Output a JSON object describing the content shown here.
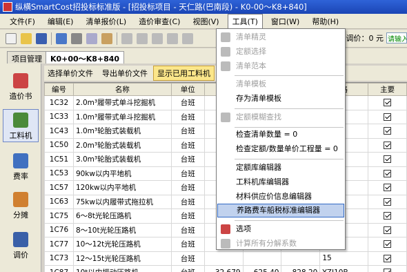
{
  "title": "纵横SmartCost招投标标准版 - [招投标项目 - 天仁路(巴南段) - K0-00～K8+840]",
  "menu": [
    "文件(F)",
    "编辑(E)",
    "清单报价(L)",
    "造价审查(C)",
    "视图(V)",
    "工具(T)",
    "窗口(W)",
    "帮助(H)"
  ],
  "toolbar": {
    "price_label": "调价：0 元",
    "input_placeholder": "请输入"
  },
  "tabs": [
    "项目管理",
    "K0+00～K8+840"
  ],
  "sidebar": [
    "造价书",
    "工料机",
    "费率",
    "分摊",
    "调价"
  ],
  "subtoolbar": [
    "选择单价文件",
    "导出单价文件",
    "显示已用工料机"
  ],
  "table": {
    "headers": [
      "编号",
      "名称",
      "单位",
      "消",
      "",
      "",
      "格",
      "主要"
    ],
    "rows": [
      {
        "code": "1C32",
        "name": "2.0m³履带式单斗挖掘机",
        "unit": "台班",
        "v1": "",
        "v2": "",
        "v3": "",
        "spec": "五"
      },
      {
        "code": "1C33",
        "name": "1.0m³履带式单斗挖掘机",
        "unit": "台班",
        "v1": "",
        "v2": "",
        "v3": "",
        "spec": ""
      },
      {
        "code": "1C43",
        "name": "1.0m³轮胎式装载机",
        "unit": "台班",
        "v1": "",
        "v2": "",
        "v3": "",
        "spec": ""
      },
      {
        "code": "1C50",
        "name": "2.0m³轮胎式装载机",
        "unit": "台班",
        "v1": "",
        "v2": "",
        "v3": "",
        "spec": ""
      },
      {
        "code": "1C51",
        "name": "3.0m³轮胎式装载机",
        "unit": "台班",
        "v1": "",
        "v2": "",
        "v3": "",
        "spec": ""
      },
      {
        "code": "1C53",
        "name": "90kw以内平地机",
        "unit": "台班",
        "v1": "",
        "v2": "",
        "v3": "",
        "spec": ""
      },
      {
        "code": "1C57",
        "name": "120kw以内平地机",
        "unit": "台班",
        "v1": "",
        "v2": "",
        "v3": "",
        "spec": ""
      },
      {
        "code": "1C63",
        "name": "75kw以内履带式拖拉机",
        "unit": "台班",
        "v1": "",
        "v2": "",
        "v3": "",
        "spec": ""
      },
      {
        "code": "1C75",
        "name": "6～8t光轮压路机",
        "unit": "台班",
        "v1": "",
        "v2": "",
        "v3": "",
        "spec": ""
      },
      {
        "code": "1C76",
        "name": "8～10t光轮压路机",
        "unit": "台班",
        "v1": "",
        "v2": "",
        "v3": "",
        "spec": "10"
      },
      {
        "code": "1C77",
        "name": "10～12t光轮压路机",
        "unit": "台班",
        "v1": "",
        "v2": "",
        "v3": "",
        "spec": "12"
      },
      {
        "code": "1C73",
        "name": "12～15t光轮压路机",
        "unit": "台班",
        "v1": "",
        "v2": "",
        "v3": "",
        "spec": "15"
      },
      {
        "code": "1C87",
        "name": "10t以内振动压路机",
        "unit": "台班",
        "v1": "32.679",
        "v2": "625.40",
        "v3": "828.20",
        "spec": "YZJ10B"
      }
    ]
  },
  "dropdown": [
    {
      "label": "清单精灵",
      "disabled": true,
      "icon": "wizard-icon"
    },
    {
      "label": "定额选择",
      "disabled": true,
      "icon": "quota-select-icon"
    },
    {
      "label": "清单范本",
      "disabled": true,
      "icon": "template-icon"
    },
    {
      "label": "清单模板",
      "disabled": true
    },
    {
      "label": "存为清单模板",
      "disabled": false
    },
    {
      "label": "定额模糊查找",
      "disabled": true,
      "icon": "search-icon"
    },
    {
      "label": "检查清单数量 = 0",
      "disabled": false
    },
    {
      "label": "检查定额/数量单价工程量 = 0",
      "disabled": false
    },
    {
      "label": "定额库编辑器",
      "disabled": false
    },
    {
      "label": "工料机库编辑器",
      "disabled": false
    },
    {
      "label": "材料供应价信息编辑器",
      "disabled": false
    },
    {
      "label": "养路费车船税标准编辑器",
      "disabled": false,
      "hover": true
    },
    {
      "label": "选项",
      "disabled": false,
      "icon": "options-icon"
    },
    {
      "label": "计算所有分解系数",
      "disabled": true,
      "icon": "calc-icon"
    }
  ]
}
